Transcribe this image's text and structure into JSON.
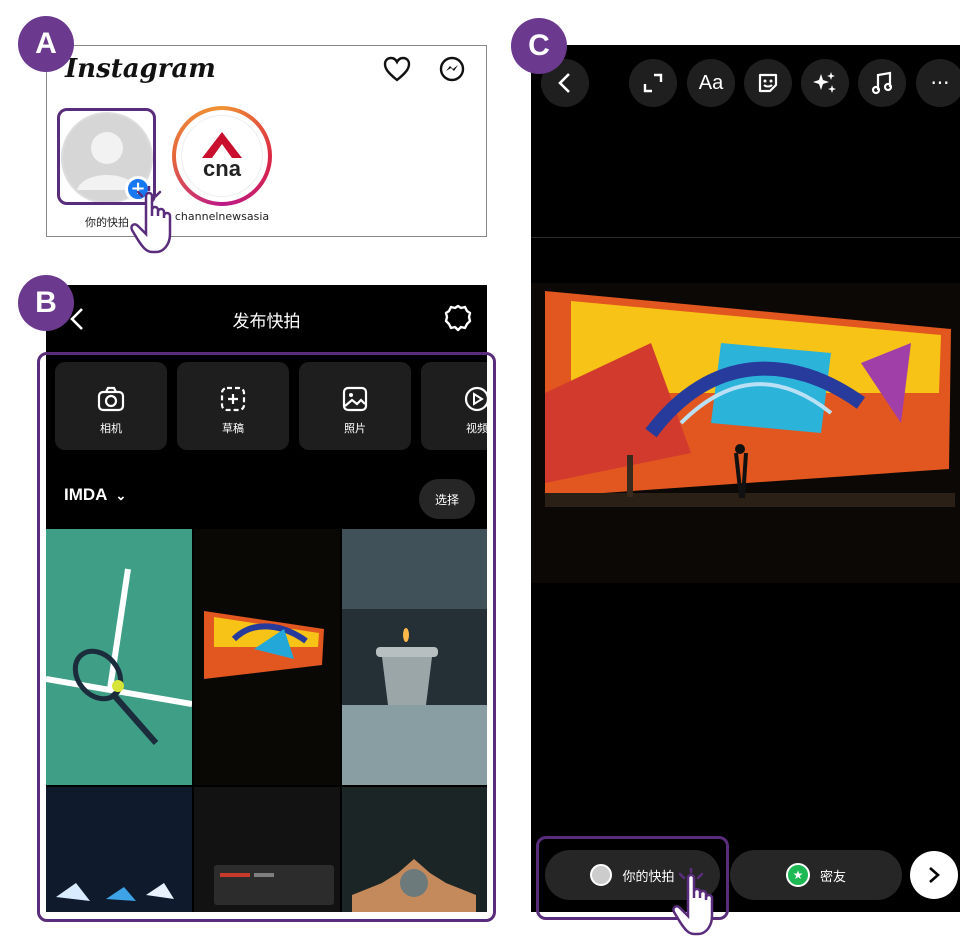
{
  "labels": {
    "a": "A",
    "b": "B",
    "c": "C"
  },
  "panel_a": {
    "logo": "Instagram",
    "your_story_label": "你的快拍",
    "cna_label": "channelnewsasia",
    "cna_logo_text": "cna"
  },
  "panel_b": {
    "title": "发布快拍",
    "tiles": [
      {
        "label": "相机",
        "icon": "camera-icon"
      },
      {
        "label": "草稿",
        "icon": "drafts-icon"
      },
      {
        "label": "照片",
        "icon": "photo-icon"
      },
      {
        "label": "视频",
        "icon": "video-icon"
      }
    ],
    "album": "IMDA",
    "select_label": "选择"
  },
  "panel_c": {
    "text_tool_label": "Aa",
    "more_label": "···",
    "your_story_label": "你的快拍",
    "close_friends_label": "密友"
  },
  "colors": {
    "accent_purple": "#6b3a8e",
    "close_friends_green": "#1db954",
    "plus_blue": "#1877f2",
    "tennis_green": "#3f9e86"
  }
}
